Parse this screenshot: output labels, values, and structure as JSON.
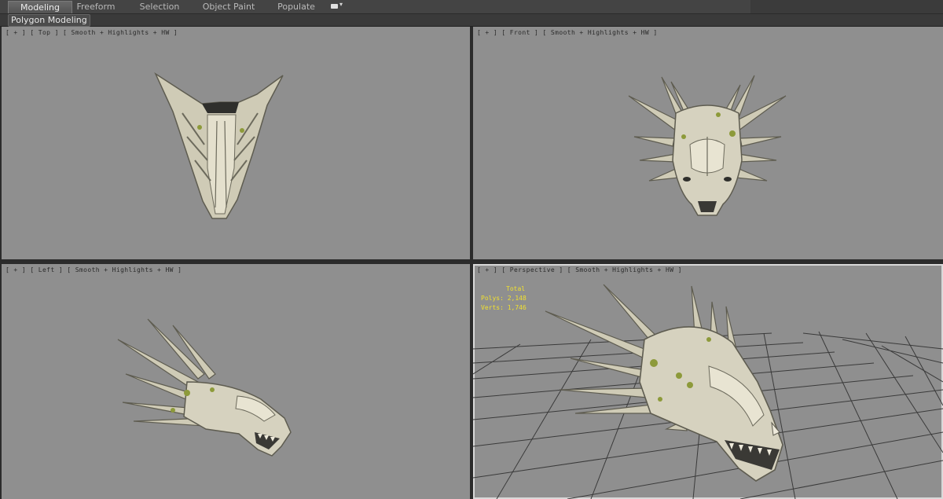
{
  "tabs": [
    {
      "label": "Modeling",
      "active": true
    },
    {
      "label": "Freeform",
      "active": false
    },
    {
      "label": "Selection",
      "active": false
    },
    {
      "label": "Object Paint",
      "active": false
    },
    {
      "label": "Populate",
      "active": false
    }
  ],
  "ribbon": {
    "panel_label": "Polygon Modeling"
  },
  "viewports": {
    "top": {
      "plus": "[ + ]",
      "view": "[ Top ]",
      "shading": "[ Smooth + Highlights + HW ]"
    },
    "front": {
      "plus": "[ + ]",
      "view": "[ Front ]",
      "shading": "[ Smooth + Highlights + HW ]"
    },
    "left": {
      "plus": "[ + ]",
      "view": "[ Left ]",
      "shading": "[ Smooth + Highlights + HW ]"
    },
    "perspective": {
      "plus": "[ + ]",
      "view": "[ Perspective ]",
      "shading": "[ Smooth + Highlights + HW ]"
    }
  },
  "stats": {
    "header": "Total",
    "polys_label": "Polys:",
    "polys_value": "2,148",
    "verts_label": "Verts:",
    "verts_value": "1,746"
  },
  "colors": {
    "viewport_bg": "#8f8f8f",
    "model_bone": "#d6d2bf",
    "model_shadow": "#6c6a5c",
    "moss": "#8d9a3a",
    "stats_text": "#f0e030",
    "grid": "#3a3a3a"
  }
}
